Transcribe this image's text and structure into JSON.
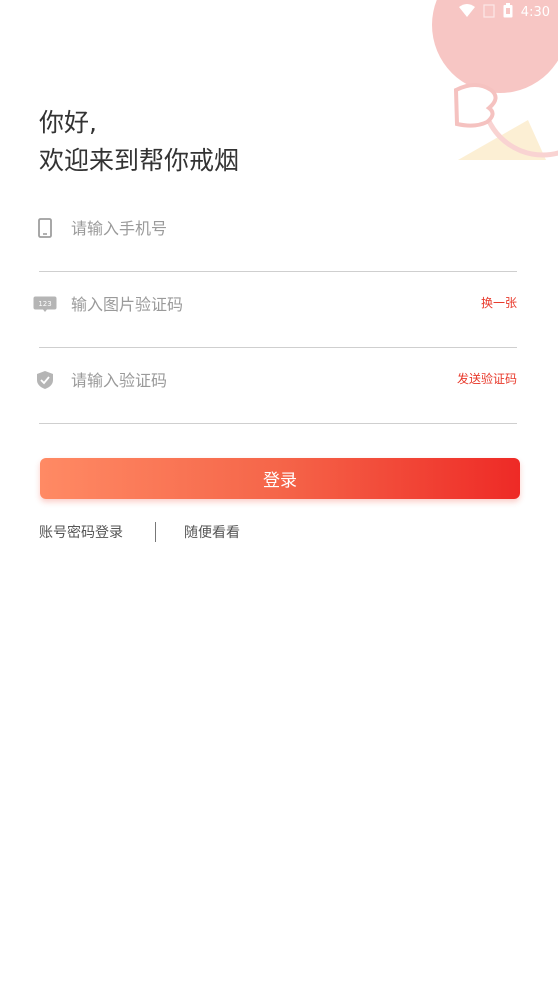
{
  "status_bar": {
    "time": "4:30",
    "icons": [
      "wifi-icon",
      "signal-icon",
      "battery-icon"
    ]
  },
  "greeting": {
    "line1": "你好,",
    "line2": "欢迎来到帮你戒烟"
  },
  "form": {
    "phone": {
      "icon": "phone-icon",
      "placeholder": "请输入手机号"
    },
    "captcha": {
      "icon": "captcha-123-icon",
      "placeholder": "输入图片验证码",
      "action": "换一张"
    },
    "sms_code": {
      "icon": "shield-check-icon",
      "placeholder": "请输入验证码",
      "action": "发送验证码"
    }
  },
  "login_button": {
    "label": "登录"
  },
  "links": {
    "password_login": "账号密码登录",
    "browse": "随便看看"
  },
  "colors": {
    "accent": "#e8392b",
    "button_gradient_start": "#ff8a64",
    "button_gradient_end": "#ee2a26",
    "deco_pink": "#f7c6c4",
    "deco_yellow": "#fbe8c2"
  }
}
